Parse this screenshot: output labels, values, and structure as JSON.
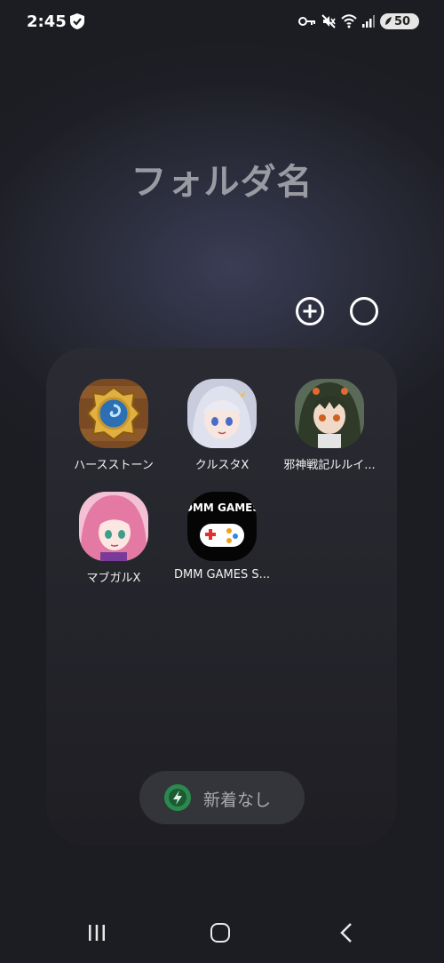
{
  "status_bar": {
    "time": "2:45",
    "battery": "50",
    "icons": [
      "shield-check-icon",
      "key-icon",
      "mute-icon",
      "wifi-icon",
      "signal-icon",
      "battery-icon"
    ]
  },
  "folder": {
    "title": "フォルダ名",
    "add_icon": "plus-circle-icon",
    "options_icon": "circle-icon"
  },
  "apps": [
    {
      "label": "ハースストーン",
      "icon": "hearthstone-icon"
    },
    {
      "label": "クルスタX",
      "icon": "crusta-x-icon"
    },
    {
      "label": "邪神戦記ルルイ...",
      "icon": "jashin-senki-icon"
    },
    {
      "label": "マブガルX",
      "icon": "mabugaru-x-icon"
    },
    {
      "label": "DMM GAMES S...",
      "icon": "dmm-games-icon"
    }
  ],
  "dmm_logo": "DMM GAMES",
  "news": {
    "label": "新着なし",
    "icon": "lightning-icon"
  },
  "nav": {
    "recent": "recent-apps-icon",
    "home": "home-icon",
    "back": "back-icon"
  },
  "colors": {
    "background": "#1e1f26",
    "panel": "#26262d",
    "title": "#9a9aa3",
    "news_icon": "#2a8a4d"
  }
}
